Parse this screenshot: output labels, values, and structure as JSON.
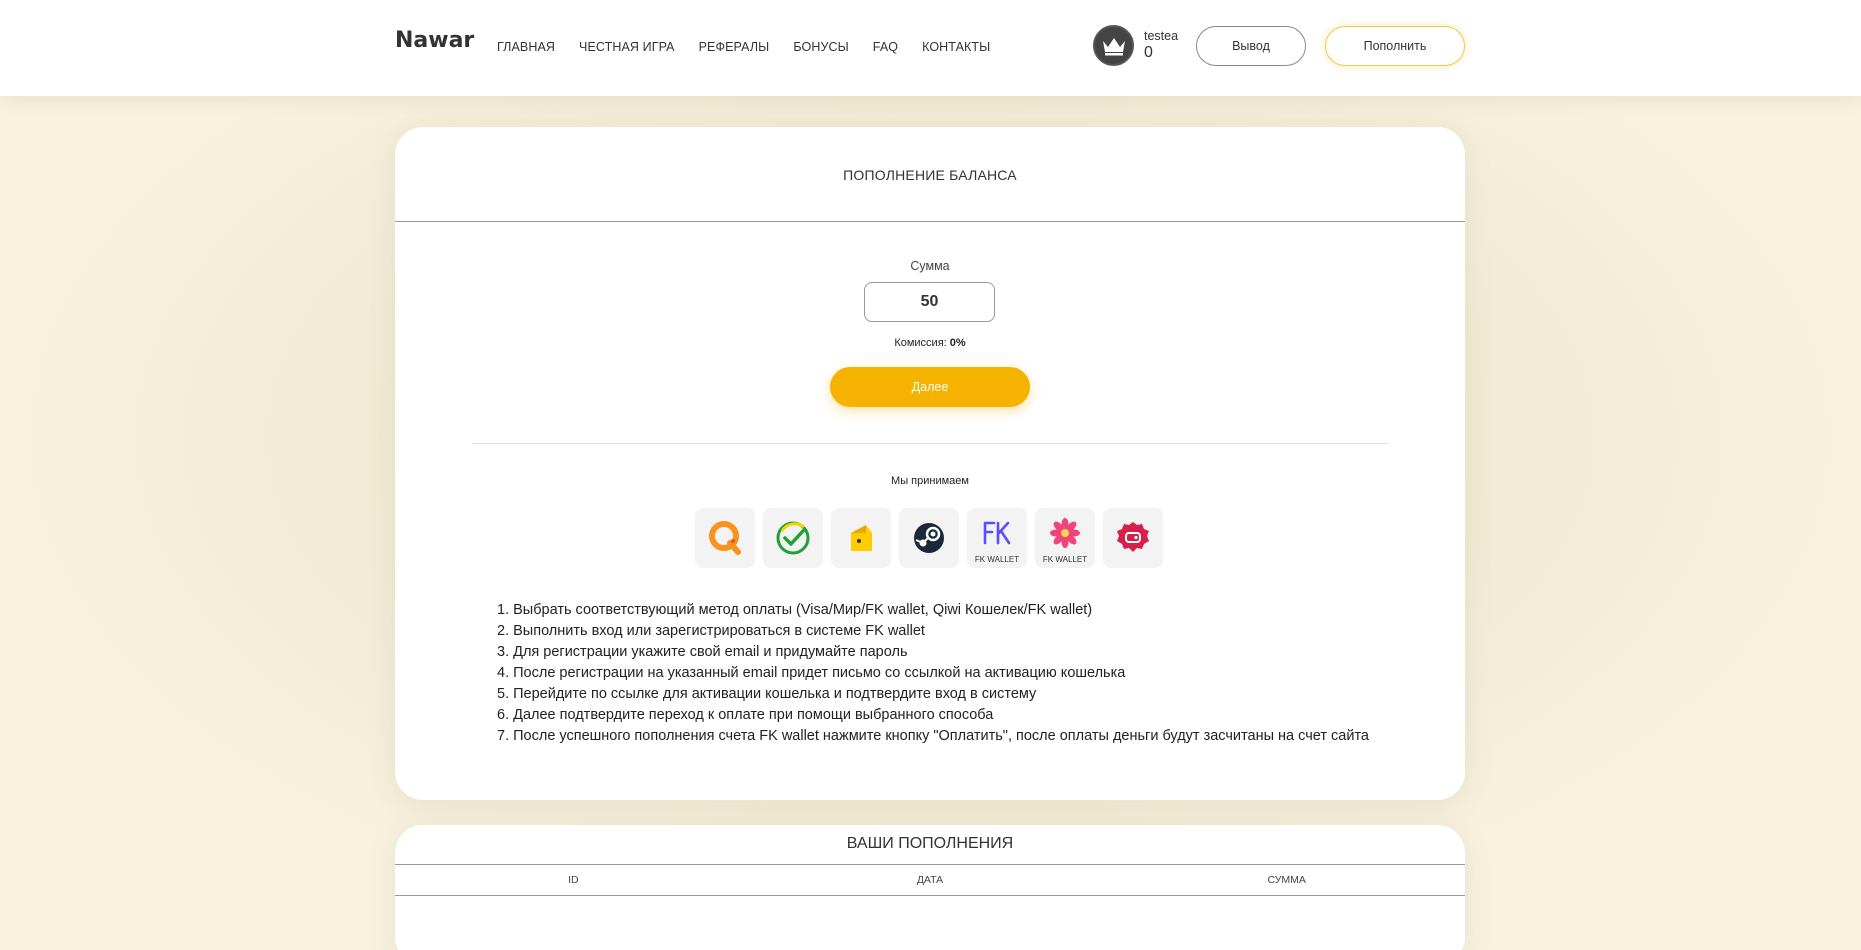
{
  "header": {
    "logo": "Nawar",
    "nav": [
      "ГЛАВНАЯ",
      "ЧЕСТНАЯ ИГРА",
      "РЕФЕРАЛЫ",
      "БОНУСЫ",
      "FAQ",
      "КОНТАКТЫ"
    ],
    "username": "testea",
    "balance": "0",
    "withdraw_label": "Вывод",
    "deposit_label": "Пополнить"
  },
  "deposit": {
    "title": "ПОПОЛНЕНИЕ БАЛАНСА",
    "sum_label": "Сумма",
    "sum_value": "50",
    "commission_label": "Комиссия:",
    "commission_value": "0%",
    "next_label": "Далее",
    "accept_label": "Мы принимаем",
    "methods": [
      {
        "icon": "qiwi-icon",
        "caption": ""
      },
      {
        "icon": "sberbank-icon",
        "caption": ""
      },
      {
        "icon": "yoomoney-icon",
        "caption": ""
      },
      {
        "icon": "steam-icon",
        "caption": ""
      },
      {
        "icon": "fk-wallet-icon",
        "caption": "FK WALLET"
      },
      {
        "icon": "flower-icon",
        "caption": "FK WALLET"
      },
      {
        "icon": "badge-icon",
        "caption": ""
      }
    ],
    "steps": [
      "1. Выбрать соответствующий метод оплаты (Visa/Мир/FK wallet, Qiwi Кошелек/FK wallet)",
      "2. Выполнить вход или зарегистрироваться в системе FK wallet",
      "3. Для регистрации укажите свой email и придумайте пароль",
      "4. После регистрации на указанный email придет письмо со ссылкой на активацию кошелька",
      "5. Перейдите по ссылке для активации кошелька и подтвердите вход в систему",
      "6. Далее подтвердите переход к оплате при помощи выбранного способа",
      "7. После успешного пополнения счета FK wallet нажмите кнопку \"Оплатить\", после оплаты деньги будут засчитаны на счет сайта"
    ]
  },
  "history": {
    "title": "ВАШИ ПОПОЛНЕНИЯ",
    "columns": [
      "ID",
      "ДАТА",
      "СУММА"
    ]
  },
  "colors": {
    "accent": "#f5b300",
    "background": "#f7f1de"
  }
}
